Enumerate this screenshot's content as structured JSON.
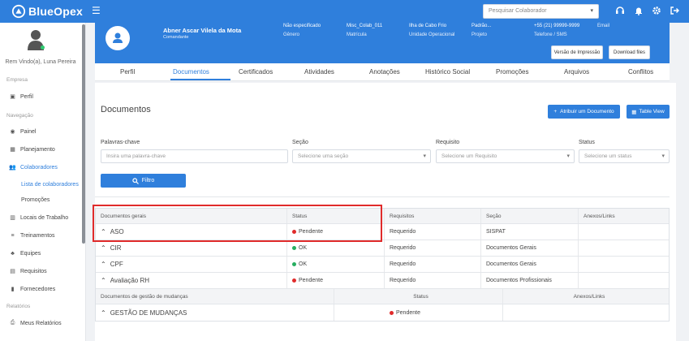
{
  "app": {
    "name": "BlueOpex",
    "search_placeholder": "Pesquisar Colaborador"
  },
  "sidebar": {
    "welcome": "Rem Vindo(a), Luna Pereira",
    "sections": {
      "empresa": "Empresa",
      "navegacao": "Navegação",
      "relatorios": "Relatórios"
    },
    "items": {
      "perfil": "Perfil",
      "painel": "Painel",
      "planejamento": "Planejamento",
      "colaboradores": "Colaboradores",
      "lista": "Lista de colaboradores",
      "promocoes": "Promoções",
      "locais": "Locais de Trabalho",
      "treinamentos": "Treinamentos",
      "equipes": "Equipes",
      "requisitos": "Requisitos",
      "fornecedores": "Fornecedores",
      "meus_relatorios": "Meus Relatórios"
    }
  },
  "profile": {
    "name": "Abner Ascar Vilela da Mota",
    "role": "Comandante",
    "gender_value": "Não especificado",
    "gender_label": "Gênero",
    "matricula_value": "Misc_Colab_011",
    "matricula_label": "Matrícula",
    "unit_value": "Ilha de Cabo Frio",
    "unit_label": "Unidade Operacional",
    "project_value": "Padrão...",
    "project_label": "Projeto",
    "phone_value": "+55 (21) 99999-9999",
    "phone_label": "Telefone / SMS",
    "email_label": "Email",
    "print_button": "Versão de Impressão",
    "download_button": "Download files"
  },
  "tabs": [
    "Perfil",
    "Documentos",
    "Certificados",
    "Atividades",
    "Anotações",
    "Histórico Social",
    "Promoções",
    "Arquivos",
    "Conflitos"
  ],
  "page": {
    "title": "Documentos",
    "assign_button": "Atribuir um Documento",
    "table_view_button": "Table View",
    "filters": {
      "keywords_label": "Palavras-chave",
      "keywords_placeholder": "Insira uma palavra-chave",
      "section_label": "Seção",
      "section_placeholder": "Selecione uma seção",
      "requirement_label": "Requisito",
      "requirement_placeholder": "Selecione um Requisito",
      "status_label": "Status",
      "status_placeholder": "Selecione um status",
      "filter_button": "Filtro"
    }
  },
  "table": {
    "headers": {
      "docs": "Documentos gerais",
      "status": "Status",
      "req": "Requisitos",
      "section": "Seção",
      "attachments": "Anexos/Links"
    },
    "rows": [
      {
        "name": "ASO",
        "status": "Pendente",
        "status_color": "#e02b2b",
        "req": "Requerido",
        "section": "SISPAT"
      },
      {
        "name": "CIR",
        "status": "OK",
        "status_color": "#27ae60",
        "req": "Requerido",
        "section": "Documentos Gerais"
      },
      {
        "name": "CPF",
        "status": "OK",
        "status_color": "#27ae60",
        "req": "Requerido",
        "section": "Documentos Gerais"
      },
      {
        "name": "Avaliação RH",
        "status": "Pendente",
        "status_color": "#e02b2b",
        "req": "Requerido",
        "section": "Documentos Profissionais"
      }
    ],
    "change_headers": {
      "docs": "Documentos de gestão de mudanças",
      "status": "Status",
      "attachments": "Anexos/Links"
    },
    "change_rows": [
      {
        "name": "GESTÃO DE MUDANÇAS",
        "status": "Pendente",
        "status_color": "#e02b2b"
      }
    ]
  }
}
